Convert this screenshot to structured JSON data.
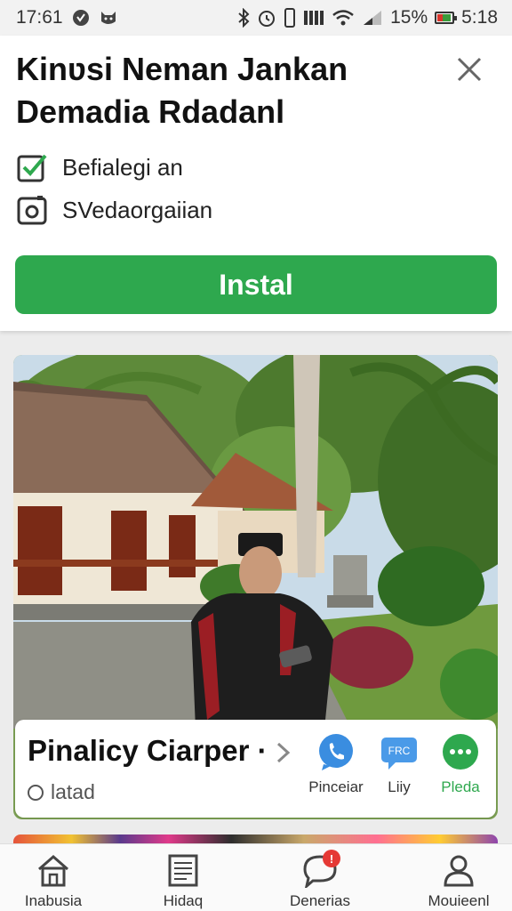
{
  "status_bar": {
    "time_left": "17:61",
    "battery_percent": "15%",
    "time_right": "5:18",
    "icons_left": [
      "vpn-shield-icon",
      "cat-icon"
    ],
    "icons_right": [
      "bluetooth-icon",
      "alarm-icon",
      "phone-icon",
      "signal-bars-icon",
      "wifi-icon",
      "cell-signal-icon",
      "battery-icon"
    ]
  },
  "install_prompt": {
    "title": "Kinʋsi Neman Jankan Demadia Rdadanl",
    "permissions": [
      {
        "label": "Befialegi an",
        "icon": "checkbox-checked-icon",
        "icon_color": "#2ea84e"
      },
      {
        "label": "SVedaorgaiian",
        "icon": "camera-icon"
      }
    ],
    "install_label": "Instal",
    "accent_color": "#2ea84e"
  },
  "post_card": {
    "title": "Pinalicy Ciarper ·",
    "status": "latad",
    "share_options": [
      {
        "label": "Pinceiar",
        "icon": "phone-bubble-icon",
        "color": "#3a8de0"
      },
      {
        "label": "Liiy",
        "icon": "chat-bubble-icon",
        "badge_text": "FRC",
        "color": "#4a9ae8"
      },
      {
        "label": "Pleda",
        "icon": "more-options-icon",
        "color": "#2ea84e"
      }
    ]
  },
  "bottom_nav": {
    "items": [
      {
        "label": "Inabusia",
        "icon": "home-icon"
      },
      {
        "label": "Hidaq",
        "icon": "document-icon"
      },
      {
        "label": "Denerias",
        "icon": "notifications-bubble-icon",
        "badge": "!"
      },
      {
        "label": "Mouieenl",
        "icon": "profile-icon"
      }
    ]
  }
}
